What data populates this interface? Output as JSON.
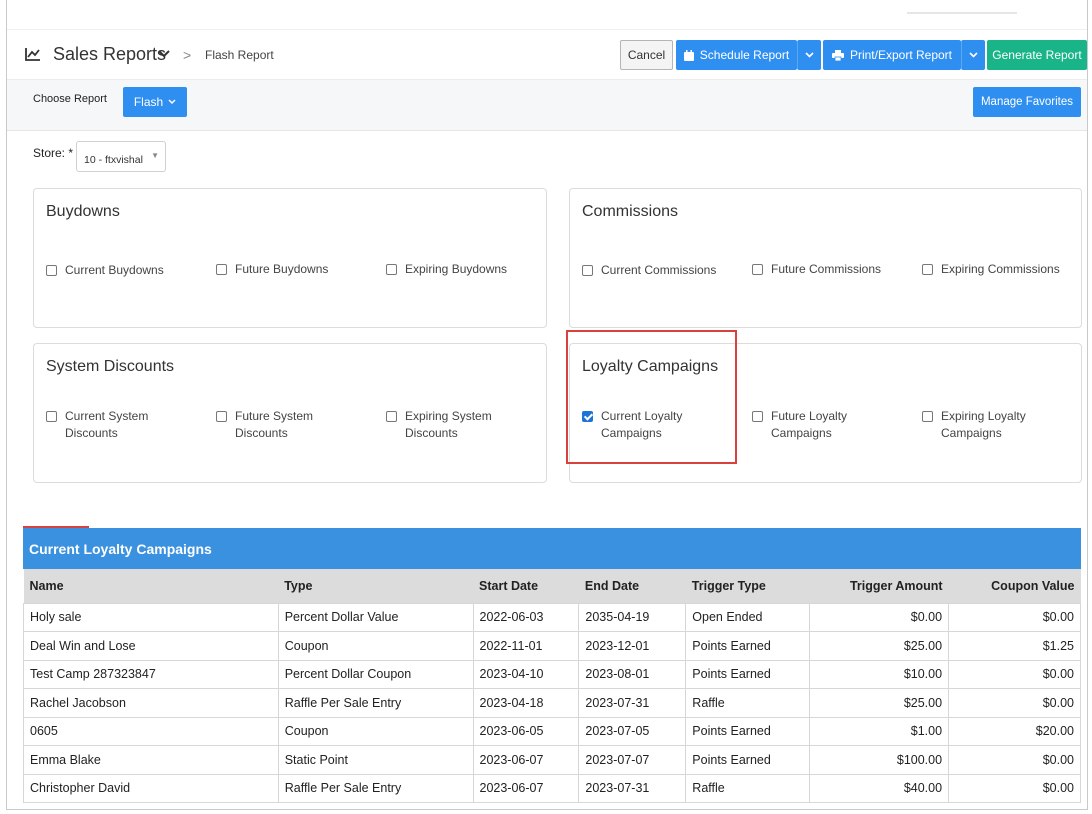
{
  "header": {
    "title": "Sales Reports",
    "breadcrumb": "Flash Report",
    "buttons": {
      "cancel": "Cancel",
      "schedule": "Schedule Report",
      "print": "Print/Export Report",
      "generate": "Generate Report"
    }
  },
  "choose": {
    "label": "Choose Report",
    "flash": "Flash",
    "manage": "Manage Favorites"
  },
  "store": {
    "label": "Store: *",
    "value": "10 - ftxvishal"
  },
  "panels": {
    "buydowns": {
      "title": "Buydowns",
      "items": [
        "Current Buydowns",
        "Future Buydowns",
        "Expiring Buydowns"
      ]
    },
    "commissions": {
      "title": "Commissions",
      "items": [
        "Current Commissions",
        "Future Commissions",
        "Expiring Commissions"
      ]
    },
    "system_discounts": {
      "title": "System Discounts",
      "items": [
        [
          "Current System",
          "Discounts"
        ],
        [
          "Future System",
          "Discounts"
        ],
        [
          "Expiring System",
          "Discounts"
        ]
      ]
    },
    "loyalty": {
      "title": "Loyalty Campaigns",
      "items": [
        [
          "Current Loyalty",
          "Campaigns"
        ],
        [
          "Future Loyalty",
          "Campaigns"
        ],
        [
          "Expiring Loyalty",
          "Campaigns"
        ]
      ],
      "checked": [
        true,
        false,
        false
      ]
    }
  },
  "report": {
    "title": "Current Loyalty Campaigns",
    "columns": [
      "Name",
      "Type",
      "Start Date",
      "End Date",
      "Trigger Type",
      "Trigger Amount",
      "Coupon Value"
    ],
    "rows": [
      [
        "Holy sale",
        "Percent Dollar Value",
        "2022-06-03",
        "2035-04-19",
        "Open Ended",
        "$0.00",
        "$0.00"
      ],
      [
        "Deal Win and Lose",
        "Coupon",
        "2022-11-01",
        "2023-12-01",
        "Points Earned",
        "$25.00",
        "$1.25"
      ],
      [
        "Test Camp 287323847",
        "Percent Dollar Coupon",
        "2023-04-10",
        "2023-08-01",
        "Points Earned",
        "$10.00",
        "$0.00"
      ],
      [
        "Rachel Jacobson",
        "Raffle Per Sale Entry",
        "2023-04-18",
        "2023-07-31",
        "Raffle",
        "$25.00",
        "$0.00"
      ],
      [
        "0605",
        "Coupon",
        "2023-06-05",
        "2023-07-05",
        "Points Earned",
        "$1.00",
        "$20.00"
      ],
      [
        "Emma Blake",
        "Static Point",
        "2023-06-07",
        "2023-07-07",
        "Points Earned",
        "$100.00",
        "$0.00"
      ],
      [
        "Christopher David",
        "Raffle Per Sale Entry",
        "2023-06-07",
        "2023-07-31",
        "Raffle",
        "$40.00",
        "$0.00"
      ]
    ]
  },
  "colors": {
    "primary": "#2f8ff1",
    "generate": "#19b588",
    "report_header": "#3a91e0",
    "highlight": "#d9423c"
  }
}
